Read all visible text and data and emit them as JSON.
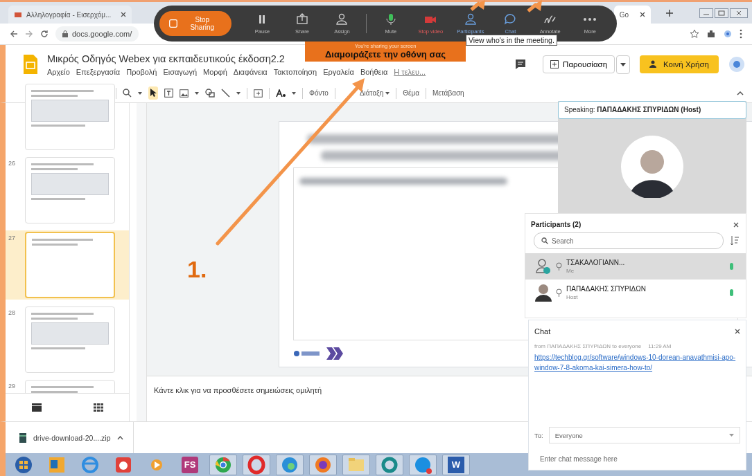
{
  "browser": {
    "tabs": [
      {
        "title": "Αλληλογραφία - Εισερχόμ...",
        "selected": false
      },
      {
        "title": "Go",
        "selected": true
      }
    ],
    "address": "docs.google.com/"
  },
  "webex_toolbar": {
    "stop_sharing": "Stop Sharing",
    "buttons": [
      {
        "kind": "pause",
        "label": "Pause"
      },
      {
        "kind": "share",
        "label": "Share"
      },
      {
        "kind": "assign",
        "label": "Assign"
      },
      {
        "kind": "mute",
        "label": "Mute"
      },
      {
        "kind": "video",
        "label": "Stop video"
      },
      {
        "kind": "participants",
        "label": "Participants"
      },
      {
        "kind": "chat",
        "label": "Chat"
      },
      {
        "kind": "annotate",
        "label": "Annotate"
      },
      {
        "kind": "more",
        "label": "More"
      }
    ]
  },
  "tooltip": "View who's in the meeting.",
  "sharing_banner": {
    "caption": "You're sharing your screen",
    "title": "Διαμοιράζετε την οθόνη σας"
  },
  "docs": {
    "title": "Μικρός Οδηγός Webex για εκπαιδευτικούς έκδοση2.2",
    "menu": [
      "Αρχείο",
      "Επεξεργασία",
      "Προβολή",
      "Εισαγωγή",
      "Μορφή",
      "Διαφάνεια",
      "Τακτοποίηση",
      "Εργαλεία",
      "Βοήθεια"
    ],
    "last_edit": "Η τελευ...",
    "present": "Παρουσίαση",
    "share": "Κοινή Χρήση",
    "toolbar_buttons": [
      "Φόντο",
      "Διάταξη",
      "Θέμα",
      "Μετάβαση"
    ]
  },
  "slides": [
    {
      "selected": false
    },
    {
      "number": "26",
      "selected": false
    },
    {
      "number": "27",
      "selected": true
    },
    {
      "number": "28",
      "selected": false
    },
    {
      "number": "29",
      "selected": false
    }
  ],
  "notes_placeholder": "Κάντε κλικ για να προσθέσετε σημειώσεις ομιλητή",
  "download": {
    "file": "drive-download-20....zip"
  },
  "speaking": "Speaking: **ΠΑΠΑΔΑΚΗΣ ΣΠΥΡΙΔΩΝ (Host)**",
  "participants": {
    "title": "Participants (2)",
    "search_placeholder": "Search",
    "items": [
      {
        "name": "ΤΣΑΚΑΛΟΓΙΑΝΝ...",
        "role": "Me",
        "kind": "generic",
        "selected": true
      },
      {
        "name": "ΠΑΠΑΔΑΚΗΣ ΣΠΥΡΙΔΩΝ",
        "role": "Host",
        "kind": "photo",
        "selected": false
      }
    ]
  },
  "chat": {
    "title": "Chat",
    "messages": [
      {
        "sender": "from ΠΑΠΑΔΑΚΗΣ ΣΠΥΡΙΔΩΝ to everyone",
        "time": "11:29 AM",
        "link": "https://techblog.gr/software/windows-10-dorean-anavathmisi-apo-window-7-8-akoma-kai-simera-how-to/"
      }
    ],
    "to_label": "To:",
    "to": "Everyone",
    "placeholder": "Enter chat message here"
  },
  "annotation": {
    "label": "1."
  },
  "taskbar": [
    {
      "kind": "start"
    },
    {
      "kind": "outlook"
    },
    {
      "kind": "ie"
    },
    {
      "kind": "red-app"
    },
    {
      "kind": "media"
    },
    {
      "kind": "letters",
      "label": "FS"
    },
    {
      "kind": "chrome"
    },
    {
      "kind": "opera"
    },
    {
      "kind": "edge"
    },
    {
      "kind": "firefox"
    },
    {
      "kind": "folder"
    },
    {
      "kind": "ring"
    },
    {
      "kind": "skype"
    },
    {
      "kind": "letters-blue",
      "label": "W"
    }
  ]
}
